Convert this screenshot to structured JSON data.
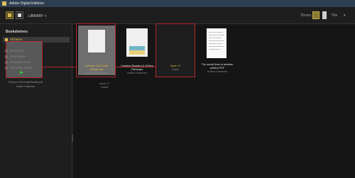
{
  "window": {
    "title": "Adobe Digital Editions"
  },
  "toolbar": {
    "library_label": "LIBRARY",
    "library_caret": "▾",
    "view_label": "Shows: ①",
    "sort_label": "Title",
    "sort_caret": "▾"
  },
  "sidebar": {
    "header": "Bookshelves",
    "items": [
      {
        "label": "All Items"
      },
      {
        "label": "Borrowed"
      },
      {
        "label": "Purchased"
      },
      {
        "label": "Recently Read"
      },
      {
        "label": "Recently Added"
      }
    ]
  },
  "drag": {
    "title": "Chinese 2010 Draft Reader.pdf",
    "author": "Author Unknown"
  },
  "books": [
    {
      "title": "Chinese 2010 Draft Reader.pdf",
      "author": "Author Unknown"
    },
    {
      "title": "Creating Reading & Writing Pathways",
      "author": "Author Unknown"
    },
    {
      "title": "Issue 17",
      "author": "Guest"
    },
    {
      "title": "The social lives of austrian politics PDF",
      "author": "Author Unknown"
    }
  ],
  "below": {
    "title": "Issue 17",
    "author": "Guest"
  },
  "colors": {
    "accent": "#e3c04a",
    "highlight": "#b3272b",
    "titlebar": "#2e3f52"
  }
}
